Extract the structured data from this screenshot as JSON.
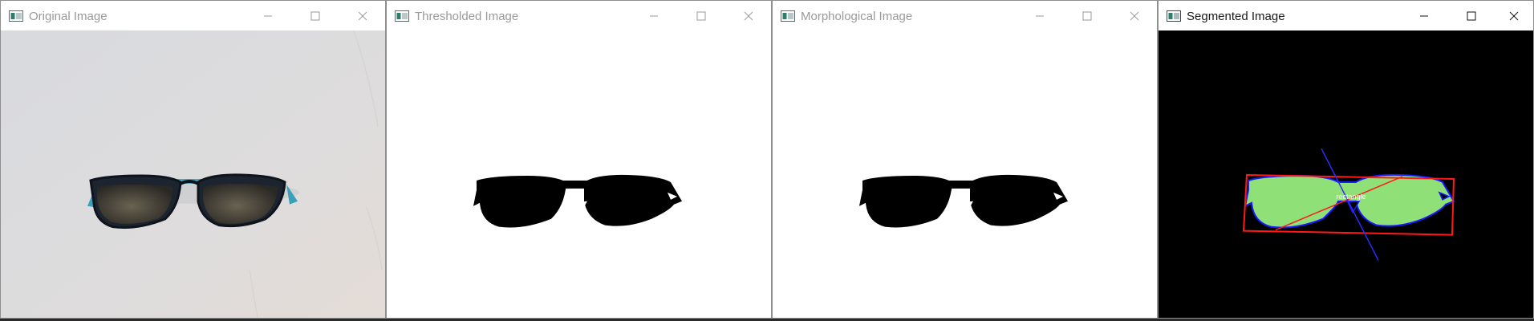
{
  "windows": [
    {
      "title": "Original Image",
      "active": false
    },
    {
      "title": "Thresholded Image",
      "active": false
    },
    {
      "title": "Morphological Image",
      "active": false
    },
    {
      "title": "Segmented Image",
      "active": true
    }
  ],
  "controls": {
    "minimize_icon": "minimize-icon",
    "maximize_icon": "maximize-icon",
    "close_icon": "close-icon"
  },
  "overlay": {
    "label": "rectangle"
  },
  "colors": {
    "segmented_fill": "#8fe076",
    "contour": "#1a1aff",
    "bounding_box": "#ff1a1a",
    "axis_line": "#2b2bff",
    "background_black": "#000000",
    "inactive_title": "#9a9a9a",
    "active_title": "#1a1a1a"
  }
}
